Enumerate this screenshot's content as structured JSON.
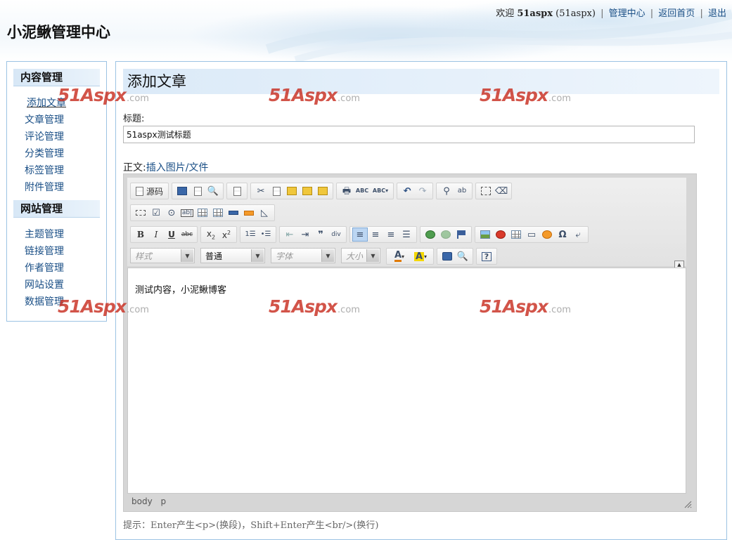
{
  "header": {
    "site_title": "小泥鳅管理中心",
    "welcome": "欢迎",
    "username": "51aspx",
    "user_paren": "(51aspx)",
    "links": [
      "管理中心",
      "返回首页",
      "退出"
    ]
  },
  "sidebar": {
    "groups": [
      {
        "title": "内容管理",
        "items": [
          "添加文章",
          "文章管理",
          "评论管理",
          "分类管理",
          "标签管理",
          "附件管理"
        ]
      },
      {
        "title": "网站管理",
        "items": [
          "主题管理",
          "链接管理",
          "作者管理",
          "网站设置",
          "数据管理"
        ]
      }
    ],
    "active_item": "添加文章"
  },
  "main": {
    "page_title": "添加文章",
    "title_label": "标题:",
    "title_value": "51aspx测试标题",
    "body_label": "正文:",
    "insert_link": "插入图片/文件"
  },
  "editor": {
    "source_label": "源码",
    "combos": {
      "style": "样式",
      "format": "普通",
      "font": "字体",
      "size": "大小"
    },
    "content": "测试内容，小泥鳅博客",
    "status_path": [
      "body",
      "p"
    ]
  },
  "hint": "提示：Enter产生<p>(换段)，Shift+Enter产生<br/>(换行)",
  "watermark": {
    "number": "51",
    "brand": "Aspx",
    "domain": ".com"
  }
}
